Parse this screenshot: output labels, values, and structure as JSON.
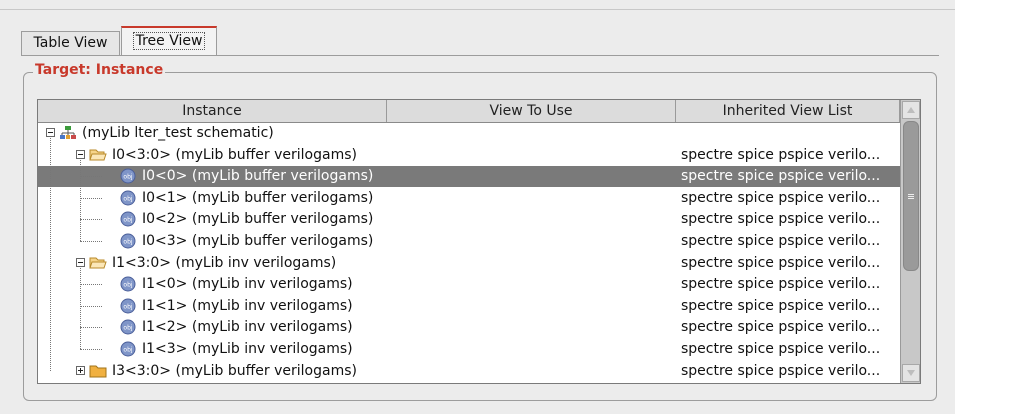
{
  "tabs": [
    {
      "label": "Table View",
      "active": false
    },
    {
      "label": "Tree View",
      "active": true
    }
  ],
  "group": {
    "title": "Target: Instance"
  },
  "table": {
    "headers": [
      "Instance",
      "View To Use",
      "Inherited View List"
    ],
    "rows": [
      {
        "instance": "(myLib lter_test schematic)",
        "view": "",
        "inherited": "",
        "icon": "hierarchy-icon",
        "expander": "minus",
        "selected": false
      },
      {
        "instance": "I0<3:0> (myLib buffer verilogams)",
        "view": "",
        "inherited": "spectre spice pspice verilo...",
        "icon": "folder-open-icon",
        "expander": "minus",
        "selected": false
      },
      {
        "instance": "I0<0> (myLib buffer verilogams)",
        "view": "",
        "inherited": "spectre spice pspice verilo...",
        "icon": "obj-icon",
        "expander": "",
        "selected": true
      },
      {
        "instance": "I0<1> (myLib buffer verilogams)",
        "view": "",
        "inherited": "spectre spice pspice verilo...",
        "icon": "obj-icon",
        "expander": "",
        "selected": false
      },
      {
        "instance": "I0<2> (myLib buffer verilogams)",
        "view": "",
        "inherited": "spectre spice pspice verilo...",
        "icon": "obj-icon",
        "expander": "",
        "selected": false
      },
      {
        "instance": "I0<3> (myLib buffer verilogams)",
        "view": "",
        "inherited": "spectre spice pspice verilo...",
        "icon": "obj-icon",
        "expander": "",
        "selected": false
      },
      {
        "instance": "I1<3:0> (myLib inv verilogams)",
        "view": "",
        "inherited": "spectre spice pspice verilo...",
        "icon": "folder-open-icon",
        "expander": "minus",
        "selected": false
      },
      {
        "instance": "I1<0> (myLib inv verilogams)",
        "view": "",
        "inherited": "spectre spice pspice verilo...",
        "icon": "obj-icon",
        "expander": "",
        "selected": false
      },
      {
        "instance": "I1<1> (myLib inv verilogams)",
        "view": "",
        "inherited": "spectre spice pspice verilo...",
        "icon": "obj-icon",
        "expander": "",
        "selected": false
      },
      {
        "instance": "I1<2> (myLib inv verilogams)",
        "view": "",
        "inherited": "spectre spice pspice verilo...",
        "icon": "obj-icon",
        "expander": "",
        "selected": false
      },
      {
        "instance": "I1<3> (myLib inv verilogams)",
        "view": "",
        "inherited": "spectre spice pspice verilo...",
        "icon": "obj-icon",
        "expander": "",
        "selected": false
      },
      {
        "instance": "I3<3:0> (myLib buffer verilogams)",
        "view": "",
        "inherited": "spectre spice pspice verilo...",
        "icon": "folder-closed-icon",
        "expander": "plus",
        "selected": false
      }
    ]
  },
  "colors": {
    "accent": "#c8392b",
    "selection": "#7a7a7a",
    "folder": "#f0b040",
    "obj": "#7f95c8"
  }
}
